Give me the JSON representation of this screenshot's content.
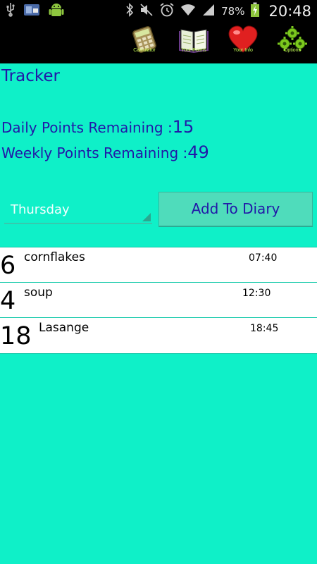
{
  "status": {
    "battery_pct": "78%",
    "time": "20:48"
  },
  "toolbar": {
    "items": [
      {
        "label": "Calculator",
        "icon": "calculator-icon"
      },
      {
        "label": "Your Points",
        "icon": "book-icon"
      },
      {
        "label": "Your Info",
        "icon": "heart-icon"
      },
      {
        "label": "Options",
        "icon": "gears-icon"
      }
    ]
  },
  "main": {
    "title": "Tracker",
    "daily_label": "Daily Points Remaining :",
    "daily_value": "15",
    "weekly_label": "Weekly Points Remaining :",
    "weekly_value": "49",
    "day_selected": "Thursday",
    "add_button": "Add To Diary"
  },
  "entries": [
    {
      "points": "6",
      "food": "cornflakes",
      "time": "07:40"
    },
    {
      "points": "4",
      "food": "soup",
      "time": "12:30"
    },
    {
      "points": "18",
      "food": "Lasange",
      "time": "18:45"
    }
  ],
  "colors": {
    "background": "#0ff0c8",
    "text": "#2218a8",
    "button": "#4fdcbb"
  }
}
